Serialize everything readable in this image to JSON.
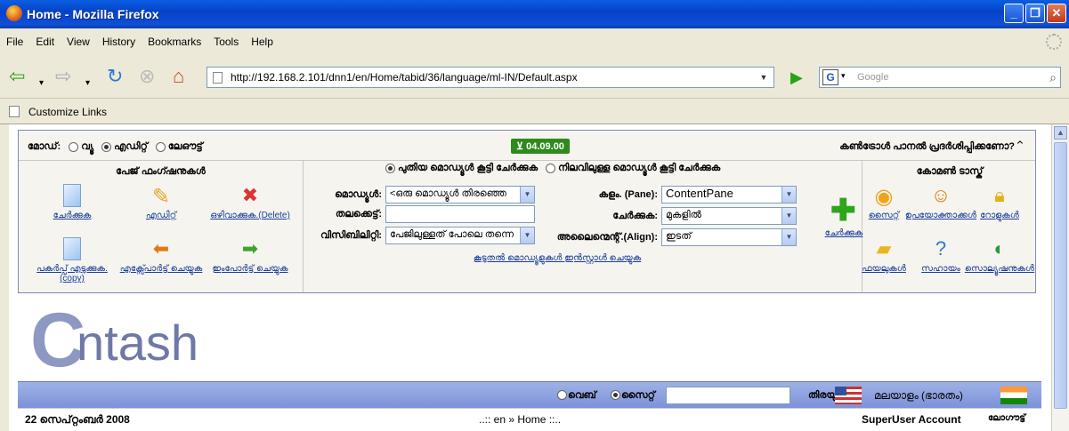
{
  "window": {
    "title": "Home - Mozilla Firefox"
  },
  "menu": [
    "File",
    "Edit",
    "View",
    "History",
    "Bookmarks",
    "Tools",
    "Help"
  ],
  "nav": {
    "url": "http://192.168.2.101/dnn1/en/Home/tabid/36/language/ml-IN/Default.aspx",
    "search_placeholder": "Google",
    "search_engine_letter": "G"
  },
  "links_bar": {
    "item": "Customize Links"
  },
  "control_panel": {
    "mode_label": "മോഡ്:",
    "modes": [
      "വ്യൂ",
      "എഡിറ്റ്",
      "ലേഔട്ട്"
    ],
    "version": "04.09.00",
    "hide_prompt": "കൺട്രോൾ പാനൽ പ്രദർശിപ്പിക്കണോ?",
    "page_functions": {
      "title": "പേജ് ഫംഗ്ഷനുകൾ",
      "items": [
        "ചേർക്കുക",
        "എഡിറ്റ്",
        "ഒഴിവാക്കുക.(Delete)",
        "പകർപ്പ് എടുക്കുക.(copy)",
        "എക്സ്പോർട്ട് ചെയ്യുക",
        "ഇംപോർട്ട് ചെയ്യുക"
      ]
    },
    "module": {
      "add_new": "പുതിയ മൊഡ്യൂൾ കൂട്ടി ചേർക്കുക",
      "add_existing": "നിലവിലുള്ള മൊഡ്യൂൾ കൂട്ടി ചേർക്കുക",
      "module_label": "മൊഡ്യൂൾ:",
      "module_value": "<ഒരു മൊഡ്യൂൾ തിരഞ്ഞെ",
      "title_label": "തലക്കെട്ട്:",
      "title_value": "",
      "visibility_label": "വിസിബിലിറ്റി:",
      "visibility_value": "പേജിലുള്ളത് പോലെ തന്നെ",
      "pane_label": "കളം. (Pane):",
      "pane_value": "ContentPane",
      "insert_label": "ചേർക്കുക:",
      "insert_value": "മുകളിൽ",
      "align_label": "അലൈന്മെന്റ്.(Align):",
      "align_value": "ഇടത്",
      "add_button": "ചേർക്കുക",
      "paste_link": "കൂടുതൽ മൊഡ്യൂളുകൾ ഇൻസ്റ്റാൾ ചെയ്യുക"
    },
    "common_tasks": {
      "title": "കോമൺ ടാസ്ക്",
      "items": [
        "സൈറ്റ്",
        "ഉപയോക്താക്കൾ",
        "റോളുകൾ",
        "ഫയലുകൾ",
        "സഹായം",
        "സൊല്യൂഷനുകൾ"
      ]
    }
  },
  "logo": {
    "first": "C",
    "rest": "ntash"
  },
  "footer": {
    "search_opts": [
      "വെബ്",
      "സൈറ്റ്"
    ],
    "search_button": "തിരയുക",
    "language": "മലയാളം (ഭാരതം)",
    "date": "22 സെപ്റ്റംബർ 2008",
    "breadcrumb": "..:: en » Home ::..",
    "user": "SuperUser Account",
    "logout": "ലോഗൗട്ട്"
  }
}
